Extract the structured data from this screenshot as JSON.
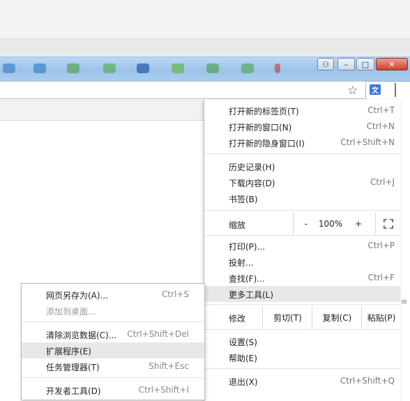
{
  "window": {
    "controls": {
      "person": "⚇",
      "minimize": "–",
      "maximize": "□",
      "close": "✕"
    }
  },
  "colors": {
    "accent_blue": "#3b78d8",
    "highlight": "#e8e8e8",
    "close_red": "#c9442b"
  },
  "main_menu": {
    "group1": [
      {
        "label": "打开新的标签页(T)",
        "shortcut": "Ctrl+T"
      },
      {
        "label": "打开新的窗口(N)",
        "shortcut": "Ctrl+N"
      },
      {
        "label": "打开新的隐身窗口(I)",
        "shortcut": "Ctrl+Shift+N"
      }
    ],
    "group2": [
      {
        "label": "历史记录(H)",
        "shortcut": ""
      },
      {
        "label": "下载内容(D)",
        "shortcut": "Ctrl+J"
      },
      {
        "label": "书签(B)",
        "shortcut": ""
      }
    ],
    "zoom": {
      "label": "缩放",
      "minus": "-",
      "value": "100%",
      "plus": "+"
    },
    "group3": [
      {
        "label": "打印(P)...",
        "shortcut": "Ctrl+P"
      },
      {
        "label": "投射...",
        "shortcut": ""
      },
      {
        "label": "查找(F)...",
        "shortcut": "Ctrl+F"
      },
      {
        "label": "更多工具(L)",
        "shortcut": ""
      }
    ],
    "edit": {
      "label": "修改",
      "cut": "剪切(T)",
      "copy": "复制(C)",
      "paste": "粘贴(P)"
    },
    "group4": [
      {
        "label": "设置(S)",
        "shortcut": ""
      },
      {
        "label": "帮助(E)",
        "shortcut": ""
      }
    ],
    "exit": {
      "label": "退出(X)",
      "shortcut": "Ctrl+Shift+Q"
    }
  },
  "sub_menu": {
    "group1": [
      {
        "label": "网页另存为(A)...",
        "shortcut": "Ctrl+S"
      },
      {
        "label": "添加到桌面...",
        "shortcut": ""
      }
    ],
    "group2": [
      {
        "label": "清除浏览数据(C)...",
        "shortcut": "Ctrl+Shift+Del"
      },
      {
        "label": "扩展程序(E)",
        "shortcut": ""
      },
      {
        "label": "任务管理器(T)",
        "shortcut": "Shift+Esc"
      }
    ],
    "group3": [
      {
        "label": "开发者工具(D)",
        "shortcut": "Ctrl+Shift+I"
      }
    ]
  },
  "toolbar": {
    "star": "☆",
    "translate": "文"
  }
}
